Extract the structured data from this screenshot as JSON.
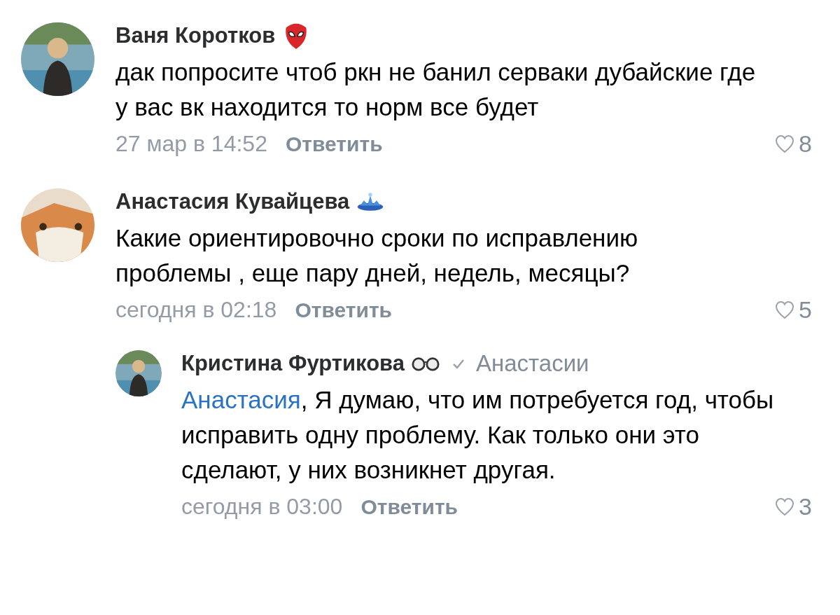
{
  "comments": [
    {
      "author": "Ваня Коротков",
      "badge": {
        "kind": "mask"
      },
      "avatar": {
        "kind": "woman"
      },
      "text": "дак попросите чтоб ркн не банил серваки дубайские где у вас вк находится то норм все будет",
      "date": "27 мар в 14:52",
      "reply_label": "Ответить",
      "likes": "8"
    },
    {
      "author": "Анастасия Кувайцева",
      "badge": {
        "kind": "crown"
      },
      "avatar": {
        "kind": "fox"
      },
      "text": "Какие ориентировочно сроки по исправлению проблемы , еще пару дней, недель, месяцы?",
      "date": "сегодня в 02:18",
      "reply_label": "Ответить",
      "likes": "5",
      "replies": [
        {
          "author": "Кристина Фуртикова",
          "badge": {
            "kind": "glasses"
          },
          "avatar": {
            "kind": "woman"
          },
          "reply_to": "Анастасии",
          "mention": "Анастасия",
          "text": ", Я думаю, что им потребуется год, чтобы исправить одну проблему. Как только они это сделают, у них возникнет другая.",
          "date": "сегодня в 03:00",
          "reply_label": "Ответить",
          "likes": "3"
        }
      ]
    }
  ]
}
